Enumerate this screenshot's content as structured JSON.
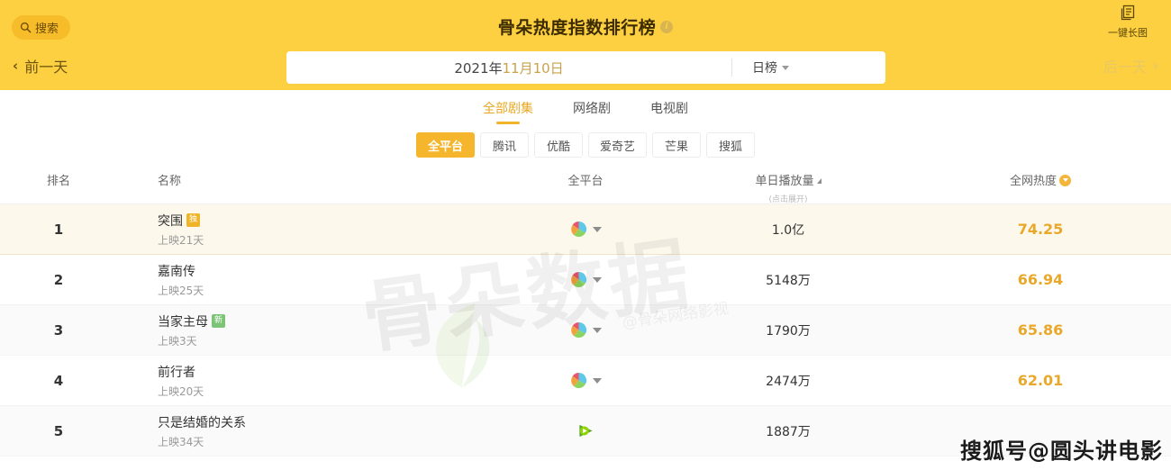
{
  "header": {
    "search_label": "搜索",
    "search_icon": "search-icon",
    "title": "骨朵热度指数排行榜",
    "info_icon": "i",
    "prev_day": "前一天",
    "prev_chevron": "‹",
    "next_day": "后一天",
    "next_chevron": "›",
    "long_image_label": "一键长图",
    "long_image_icon": "copy-pages-icon",
    "date_year": "2021年",
    "date_month_day": "11月10日",
    "rank_type": "日榜"
  },
  "tabs": [
    {
      "label": "全部剧集",
      "active": true
    },
    {
      "label": "网络剧",
      "active": false
    },
    {
      "label": "电视剧",
      "active": false
    }
  ],
  "platforms": [
    {
      "label": "全平台",
      "active": true
    },
    {
      "label": "腾讯",
      "active": false
    },
    {
      "label": "优酷",
      "active": false
    },
    {
      "label": "爱奇艺",
      "active": false
    },
    {
      "label": "芒果",
      "active": false
    },
    {
      "label": "搜狐",
      "active": false
    }
  ],
  "table": {
    "columns": {
      "rank": "排名",
      "name": "名称",
      "platform": "全平台",
      "play": "单日播放量",
      "play_note": "(点击展开)",
      "heat": "全网热度"
    },
    "rows": [
      {
        "rank": "1",
        "title": "突围",
        "badge": "独",
        "badge_color": "#f0b429",
        "release": "上映21天",
        "platform_icon": "multi-platform-wheel-icon",
        "play": "1.0亿",
        "heat": "74.25"
      },
      {
        "rank": "2",
        "title": "嘉南传",
        "badge": "",
        "badge_color": "",
        "release": "上映25天",
        "platform_icon": "multi-platform-wheel-icon",
        "play": "5148万",
        "heat": "66.94"
      },
      {
        "rank": "3",
        "title": "当家主母",
        "badge": "新",
        "badge_color": "#7cc576",
        "release": "上映3天",
        "platform_icon": "multi-platform-wheel-icon",
        "play": "1790万",
        "heat": "65.86"
      },
      {
        "rank": "4",
        "title": "前行者",
        "badge": "",
        "badge_color": "",
        "release": "上映20天",
        "platform_icon": "multi-platform-wheel-icon",
        "play": "2474万",
        "heat": "62.01"
      },
      {
        "rank": "5",
        "title": "只是结婚的关系",
        "badge": "",
        "badge_color": "",
        "release": "上映34天",
        "platform_icon": "iqiyi-play-icon",
        "play": "1887万",
        "heat": ""
      }
    ]
  },
  "watermarks": {
    "center": "骨朵数据",
    "center_sub": "@骨朵网络影视",
    "corner": "搜狐号@圆头讲电影"
  },
  "colors": {
    "brand_yellow": "#fcd040",
    "accent_orange": "#f5b52c",
    "heat_text": "#e9a82a",
    "row1_bg": "#fdf8ec"
  }
}
